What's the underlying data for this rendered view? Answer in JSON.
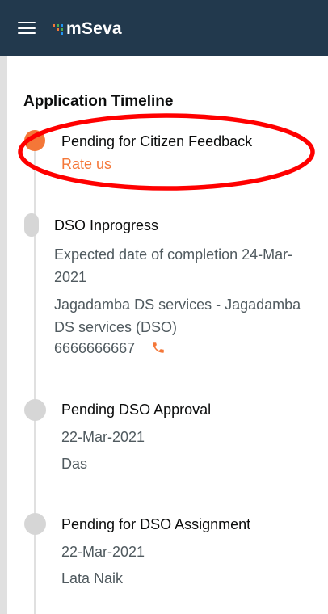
{
  "header": {
    "app_name": "mSeva",
    "menu_icon": "hamburger-menu-icon",
    "bg_color": "#22394d"
  },
  "timeline": {
    "title": "Application Timeline",
    "accent_color": "#f47738",
    "items": [
      {
        "status": "Pending for Citizen Feedback",
        "action": "Rate us",
        "active": true
      },
      {
        "status": "DSO Inprogress",
        "expected": "Expected date of completion 24-Mar-2021",
        "vendor": "Jagadamba DS services - Jagadamba DS services (DSO)",
        "phone": "6666666667",
        "phone_icon": "phone-icon"
      },
      {
        "status": "Pending DSO Approval",
        "date": "22-Mar-2021",
        "name": "Das"
      },
      {
        "status": "Pending for DSO Assignment",
        "date": "22-Mar-2021",
        "name": "Lata Naik"
      }
    ]
  },
  "annotation": {
    "type": "red-ellipse-highlight",
    "color": "#ff0000"
  }
}
